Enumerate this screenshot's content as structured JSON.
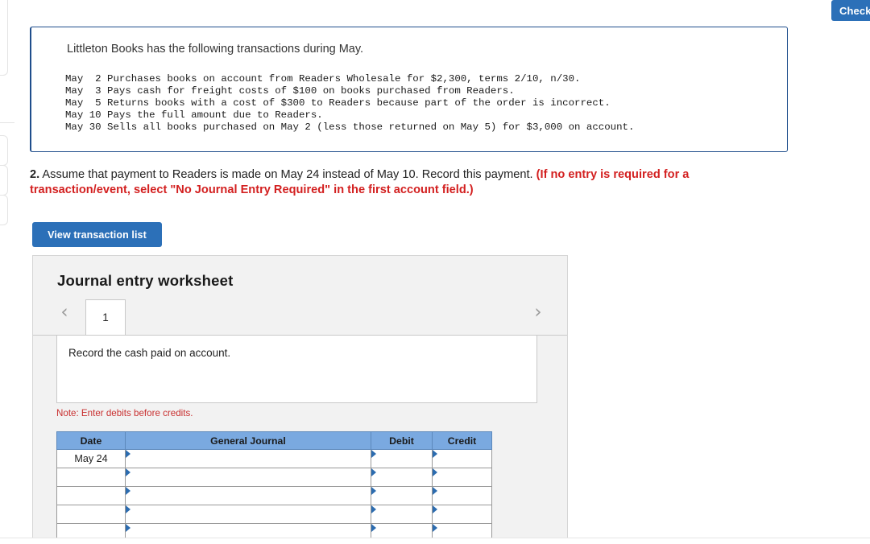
{
  "header": {
    "check_button_label": "Check"
  },
  "transaction_box": {
    "intro": "Littleton Books has the following transactions during May.",
    "transactions": "May  2 Purchases books on account from Readers Wholesale for $2,300, terms 2/10, n/30.\nMay  3 Pays cash for freight costs of $100 on books purchased from Readers.\nMay  5 Returns books with a cost of $300 to Readers because part of the order is incorrect.\nMay 10 Pays the full amount due to Readers.\nMay 30 Sells all books purchased on May 2 (less those returned on May 5) for $3,000 on account."
  },
  "question": {
    "number": "2.",
    "body": " Assume that payment to Readers is made on May 24 instead of May 10. Record this payment. ",
    "hint": "(If no entry is required for a transaction/event, select \"No Journal Entry Required\" in the first account field.)"
  },
  "toolbar": {
    "view_transaction_list_label": "View transaction list"
  },
  "worksheet": {
    "title": "Journal entry worksheet",
    "prev_icon": "‹",
    "next_icon": "›",
    "tabs": [
      {
        "label": "1",
        "selected": true
      }
    ],
    "entry_description": "Record the cash paid on account.",
    "note": "Note: Enter debits before credits."
  },
  "journal_table": {
    "columns": [
      "Date",
      "General Journal",
      "Debit",
      "Credit"
    ],
    "rows": [
      {
        "date": "May 24",
        "general_journal": "",
        "debit": "",
        "credit": ""
      },
      {
        "date": "",
        "general_journal": "",
        "debit": "",
        "credit": ""
      },
      {
        "date": "",
        "general_journal": "",
        "debit": "",
        "credit": ""
      },
      {
        "date": "",
        "general_journal": "",
        "debit": "",
        "credit": ""
      },
      {
        "date": "",
        "general_journal": "",
        "debit": "",
        "credit": ""
      }
    ]
  },
  "colors": {
    "primary_button": "#2c70b8",
    "callout_border": "#1f4e8c",
    "table_header": "#7aa9e0",
    "alert_text": "#d32020",
    "panel_background": "#f2f2f2"
  }
}
